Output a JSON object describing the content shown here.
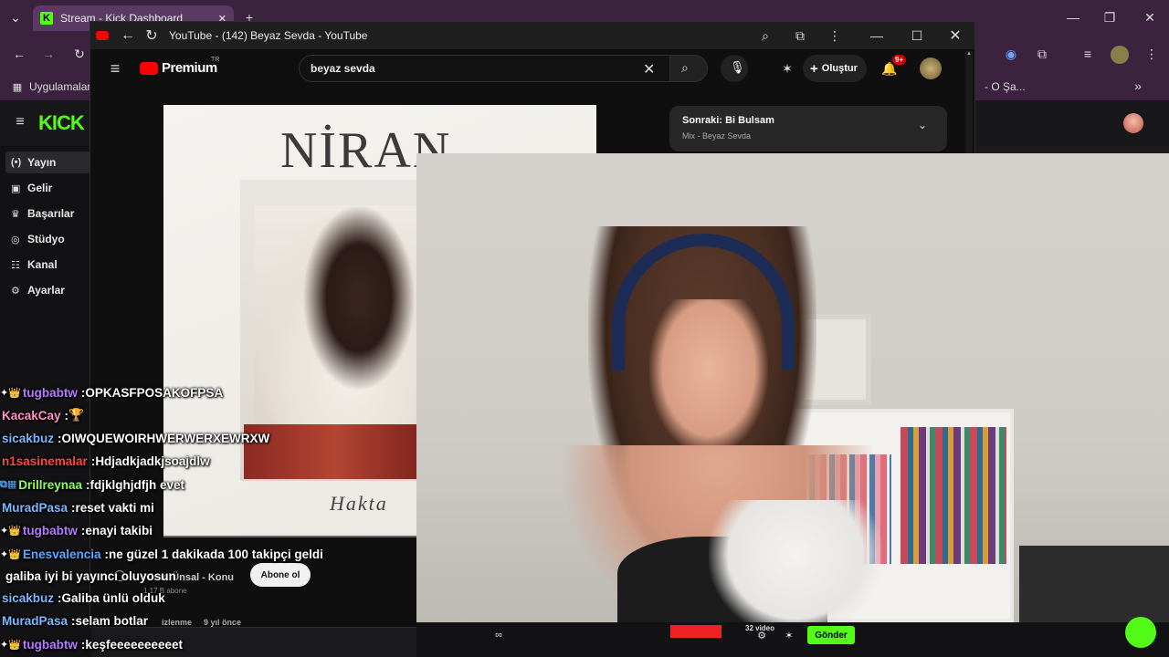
{
  "outer_browser": {
    "tab_title": "Stream - Kick Dashboard",
    "tab_close": "✕",
    "new_tab": "+",
    "bookmarks_label": "Uygulamalar",
    "bookmark_right": "- O Şa...",
    "more_bookmarks": "»"
  },
  "kick": {
    "logo": "KICK",
    "sidebar": [
      {
        "label": "Yayın",
        "icon": "(•)"
      },
      {
        "label": "Gelir",
        "icon": "▣"
      },
      {
        "label": "Başarılar",
        "icon": "♛"
      },
      {
        "label": "Stüdyo",
        "icon": "◎"
      },
      {
        "label": "Kanal",
        "icon": "☷"
      },
      {
        "label": "Ayarlar",
        "icon": "⚙"
      }
    ],
    "send_button": "Gönder"
  },
  "youtube": {
    "window_title": "YouTube - (142) Beyaz Sevda - YouTube",
    "logo": "Premium",
    "logo_region": "TR",
    "search_value": "beyaz sevda",
    "create_label": "Oluştur",
    "notifications_count": "9+",
    "album_title": "NİRAN ÜNSAL",
    "album_subtitle": "Hakta",
    "up_next_title": "Sonraki: Bi Bulsam",
    "up_next_sub": "Mix - Beyaz Sevda",
    "channel_name": "Niran Ünsal - Konu",
    "subscribers": "1,17 B abone",
    "subscribe": "Abone ol",
    "views_text": "izlenme",
    "time_ago": "9 yıl önce",
    "video_count": "32 video"
  },
  "chat": [
    {
      "user": "tugbabtw",
      "badges": "✦👑",
      "color": "#b57bff",
      "sep": " : ",
      "text": "OPKASFPOSAKOFPSA"
    },
    {
      "user": "KacakCay",
      "badges": "",
      "color": "#ff8fc8",
      "sep": " : ",
      "text": "🏆"
    },
    {
      "user": "sicakbuz",
      "badges": "",
      "color": "#7ab8ff",
      "sep": " : ",
      "text": "OIWQUEWOIRHWERWERXEWRXW"
    },
    {
      "user": "n1sasinemalar",
      "badges": "",
      "color": "#ff4646",
      "sep": " : ",
      "text": "Hdjadkjadkjsoajdlw"
    },
    {
      "user": "Drillreynaa",
      "badges": "⧉▦",
      "color": "#8dff5a",
      "sep": " : ",
      "text": "fdjklghjdfjh evet"
    },
    {
      "user": "MuradPasa",
      "badges": "",
      "color": "#7ab8ff",
      "sep": " : ",
      "text": "reset vakti mi"
    },
    {
      "user": "tugbabtw",
      "badges": "✦👑",
      "color": "#b57bff",
      "sep": " : ",
      "text": "enayi takibi"
    },
    {
      "user": "Enesvalencia",
      "badges": "✦👑",
      "color": "#5aa8ff",
      "sep": " : ",
      "text": "ne güzel 1 dakikada 100 takipçi geldi"
    },
    {
      "user": "",
      "badges": "",
      "color": "#fff",
      "sep": "",
      "text": "galiba iyi bi yayıncı oluyosun"
    },
    {
      "user": "sicakbuz",
      "badges": "",
      "color": "#7ab8ff",
      "sep": " : ",
      "text": "Galiba ünlü olduk"
    },
    {
      "user": "MuradPasa",
      "badges": "",
      "color": "#7ab8ff",
      "sep": " : ",
      "text": "selam botlar"
    },
    {
      "user": "tugbabtw",
      "badges": "✦👑",
      "color": "#b57bff",
      "sep": " : ",
      "text": "keşfeeeeeeeeeet"
    }
  ]
}
